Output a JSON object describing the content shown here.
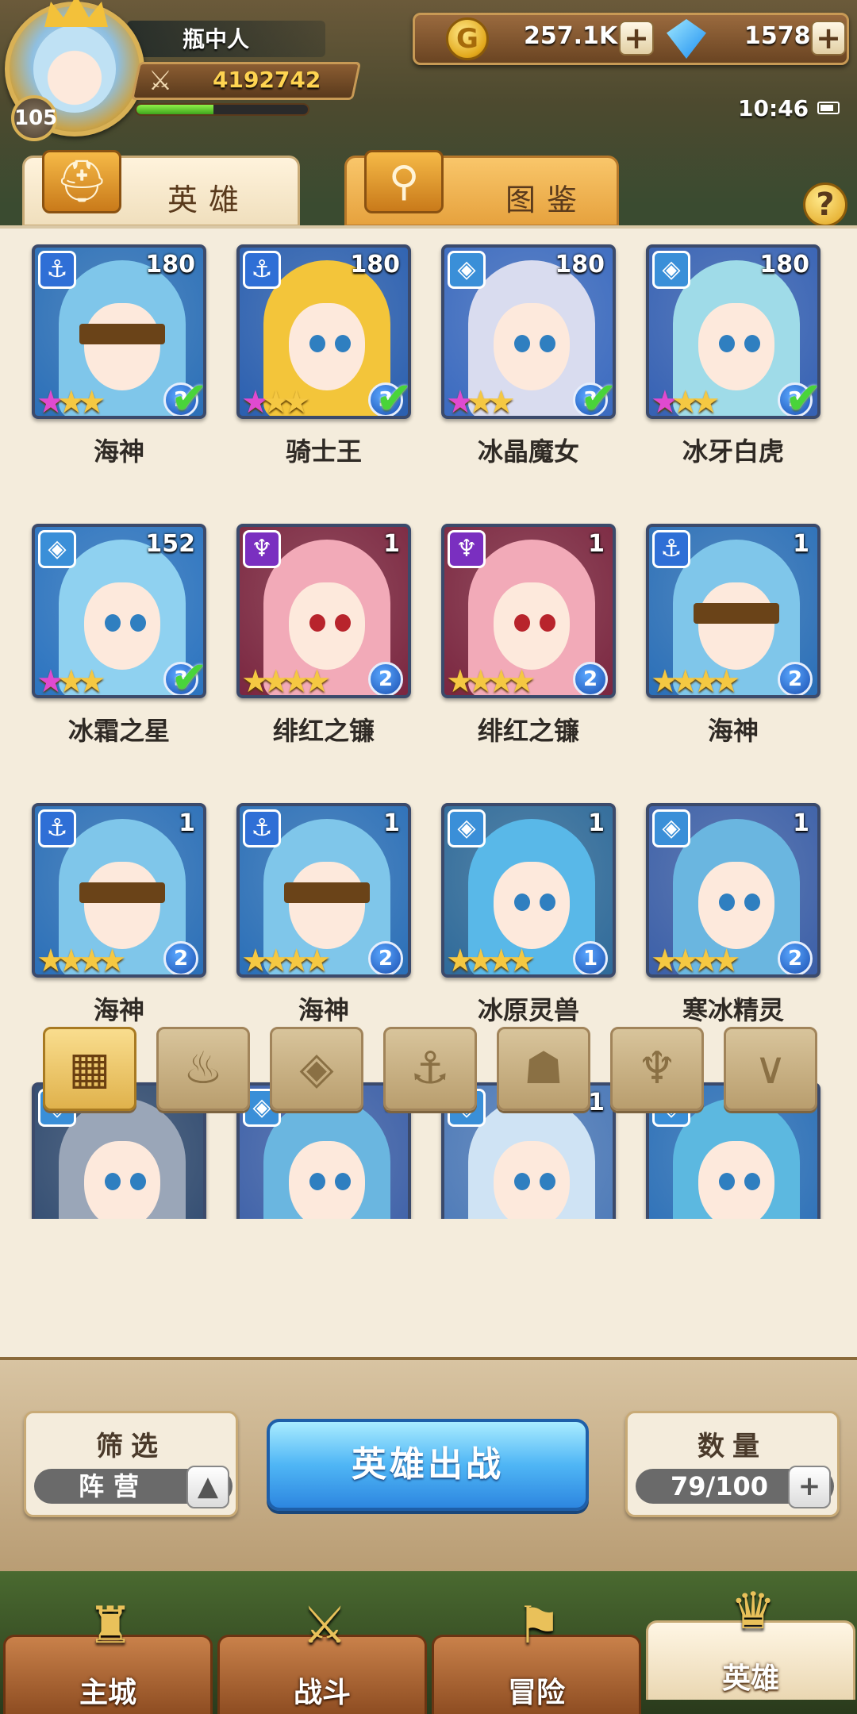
{
  "player": {
    "name": "瓶中人",
    "level": "105",
    "power": "4192742",
    "exp_fraction": 0.45
  },
  "currency": {
    "gold": "257.1K",
    "gems": "1578",
    "plus": "+"
  },
  "status": {
    "time": "10:46"
  },
  "tabs": {
    "heroes": "英雄",
    "guide": "图鉴",
    "help": "?"
  },
  "heroes": [
    {
      "name": "海神",
      "level": "180",
      "faction": "anchor",
      "stars": 3,
      "rank": "2",
      "check": true
    },
    {
      "name": "骑士王",
      "level": "180",
      "faction": "anchor",
      "stars": 3,
      "rank": "3",
      "check": true
    },
    {
      "name": "冰晶魔女",
      "level": "180",
      "faction": "diamond",
      "stars": 3,
      "rank": "3",
      "check": true
    },
    {
      "name": "冰牙白虎",
      "level": "180",
      "faction": "diamond",
      "stars": 3,
      "rank": "2",
      "check": true
    },
    {
      "name": "冰霜之星",
      "level": "152",
      "faction": "diamond",
      "stars": 3,
      "rank": "3",
      "check": true
    },
    {
      "name": "绯红之镰",
      "level": "1",
      "faction": "demon",
      "stars": 4,
      "rank": "2",
      "check": false
    },
    {
      "name": "绯红之镰",
      "level": "1",
      "faction": "demon",
      "stars": 4,
      "rank": "2",
      "check": false
    },
    {
      "name": "海神",
      "level": "1",
      "faction": "anchor",
      "stars": 4,
      "rank": "2",
      "check": false
    },
    {
      "name": "海神",
      "level": "1",
      "faction": "anchor",
      "stars": 4,
      "rank": "2",
      "check": false
    },
    {
      "name": "海神",
      "level": "1",
      "faction": "anchor",
      "stars": 4,
      "rank": "2",
      "check": false
    },
    {
      "name": "冰原灵兽",
      "level": "1",
      "faction": "diamond",
      "stars": 4,
      "rank": "1",
      "check": false
    },
    {
      "name": "寒冰精灵",
      "level": "1",
      "faction": "diamond",
      "stars": 4,
      "rank": "2",
      "check": false
    },
    {
      "name": "",
      "level": "1",
      "faction": "diamond",
      "stars": 0,
      "rank": "",
      "check": false
    },
    {
      "name": "",
      "level": "1",
      "faction": "diamond",
      "stars": 0,
      "rank": "",
      "check": false
    },
    {
      "name": "",
      "level": "1",
      "faction": "diamond",
      "stars": 0,
      "rank": "",
      "check": false
    },
    {
      "name": "",
      "level": "1",
      "faction": "diamond",
      "stars": 0,
      "rank": "",
      "check": false
    }
  ],
  "faction_filters": [
    {
      "icon": "all-grid-icon",
      "glyph": "▦",
      "active": true
    },
    {
      "icon": "flame-faction-icon",
      "glyph": "♨",
      "active": false
    },
    {
      "icon": "diamond-faction-icon",
      "glyph": "◈",
      "active": false
    },
    {
      "icon": "anchor-faction-icon",
      "glyph": "⚓",
      "active": false
    },
    {
      "icon": "beast-faction-icon",
      "glyph": "☗",
      "active": false
    },
    {
      "icon": "demon-faction-icon",
      "glyph": "♆",
      "active": false
    },
    {
      "icon": "wing-faction-icon",
      "glyph": "∨",
      "active": false
    }
  ],
  "controls": {
    "filter_title": "筛选",
    "filter_value": "阵营",
    "deploy": "英雄出战",
    "count_title": "数量",
    "count_value": "79/100"
  },
  "nav": [
    {
      "label": "主城",
      "icon": "castle-icon",
      "glyph": "♜",
      "active": false
    },
    {
      "label": "战斗",
      "icon": "crossed-swords-icon",
      "glyph": "⚔",
      "active": false
    },
    {
      "label": "冒险",
      "icon": "map-scroll-icon",
      "glyph": "⚑",
      "active": false
    },
    {
      "label": "英雄",
      "icon": "hero-helmet-icon",
      "glyph": "♛",
      "active": true
    }
  ]
}
